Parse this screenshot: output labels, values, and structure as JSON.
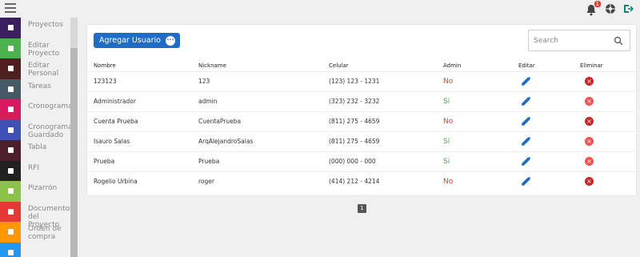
{
  "topbar": {
    "notification_count": "1"
  },
  "sidebar": {
    "items": [
      {
        "label": "Proyectos",
        "color": "#3b1f5e",
        "icon": "home-icon"
      },
      {
        "label": "Editar Proyecto",
        "color": "#4caf50",
        "icon": "pencil-icon"
      },
      {
        "label": "Editar Personal",
        "color": "#4e1f1f",
        "icon": "people-icon"
      },
      {
        "label": "Tareas",
        "color": "#455a64",
        "icon": "checklist-icon"
      },
      {
        "label": "Cronograma",
        "color": "#d81b60",
        "icon": "archive-icon"
      },
      {
        "label": "Cronograma Guardado",
        "color": "#3f51b5",
        "icon": "layers-icon"
      },
      {
        "label": "Tabla",
        "color": "#4a1f2a",
        "icon": "table-icon"
      },
      {
        "label": "RFI",
        "color": "#212121",
        "icon": "document-icon"
      },
      {
        "label": "Pizarrón",
        "color": "#8bc34a",
        "icon": "brush-icon"
      },
      {
        "label": "Documentos del Proyecto",
        "color": "#e53935",
        "icon": "file-icon"
      },
      {
        "label": "Orden de compra",
        "color": "#ff9800",
        "icon": "box-icon"
      },
      {
        "label": "",
        "color": "#2196f3",
        "icon": "more-icon"
      }
    ]
  },
  "main": {
    "add_user_label": "Agregar Usuario",
    "search_placeholder": "Search",
    "columns": [
      "Nombre",
      "Nickname",
      "Celular",
      "Admin",
      "Editar",
      "Eliminar"
    ],
    "rows": [
      {
        "nombre": "123123",
        "nickname": "123",
        "celular": "(123) 123 - 1231",
        "admin": "No",
        "del_style": "dark"
      },
      {
        "nombre": "Administrador",
        "nickname": "admin",
        "celular": "(323) 232 - 3232",
        "admin": "Si",
        "del_style": "light"
      },
      {
        "nombre": "Cuenta Prueba",
        "nickname": "CuentaPrueba",
        "celular": "(811) 275 - 4659",
        "admin": "No",
        "del_style": "dark"
      },
      {
        "nombre": "Isauro Salas",
        "nickname": "ArqAlejandroSalas",
        "celular": "(811) 275 - 4659",
        "admin": "Si",
        "del_style": "light"
      },
      {
        "nombre": "Prueba",
        "nickname": "Prueba",
        "celular": "(000) 000 - 000",
        "admin": "Si",
        "del_style": "light"
      },
      {
        "nombre": "Rogelio Urbina",
        "nickname": "roger",
        "celular": "(414) 212 - 4214",
        "admin": "No",
        "del_style": "dark"
      }
    ],
    "page": "1"
  }
}
